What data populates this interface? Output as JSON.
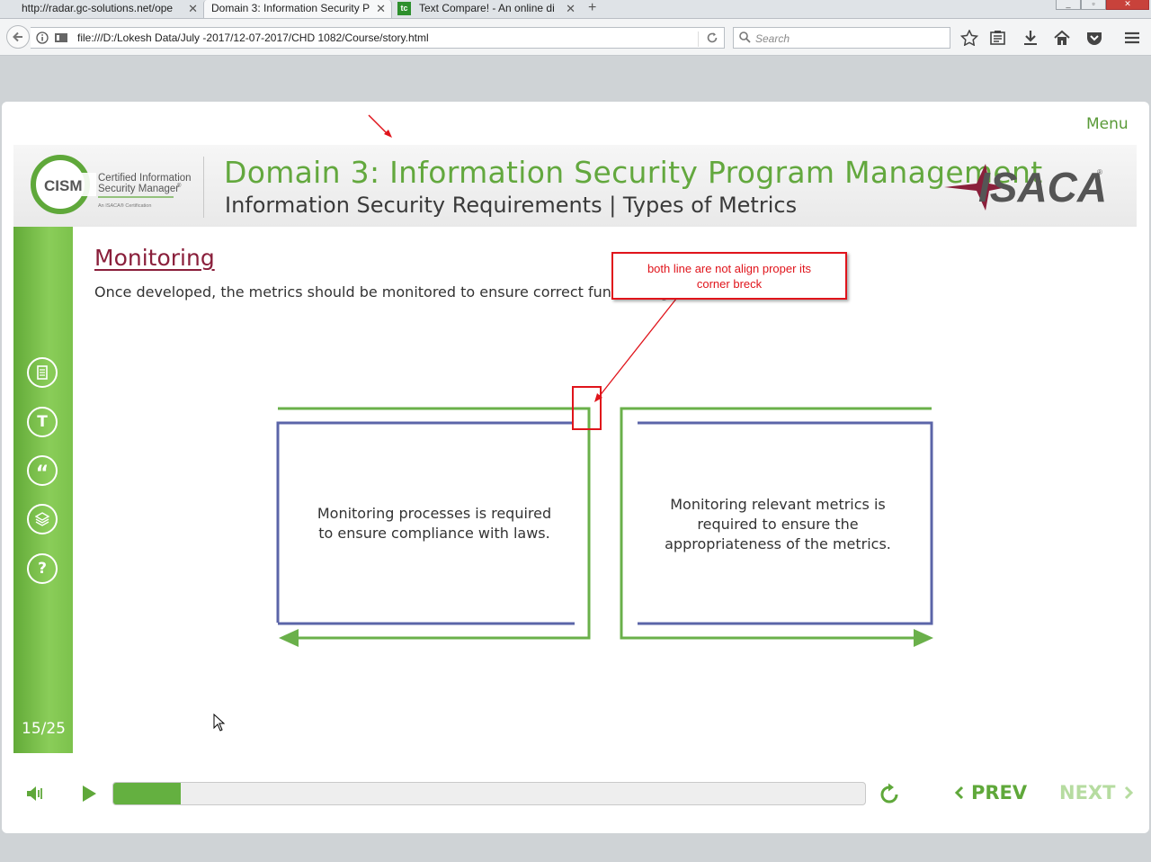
{
  "browser": {
    "tabs": [
      {
        "label": "http://radar.gc-solutions.net/ope",
        "active": false
      },
      {
        "label": "Domain 3: Information Security P",
        "active": true
      },
      {
        "label": "Text Compare! - An online di",
        "active": false,
        "favicon": "tc"
      }
    ],
    "url": "file:///D:/Lokesh Data/July -2017/12-07-2017/CHD 1082/Course/story.html",
    "search_placeholder": "Search"
  },
  "player": {
    "menu_label": "Menu",
    "header": {
      "title": "Domain 3: Information Security Program Management",
      "subtitle": "Information Security Requirements | Types of Metrics",
      "cism_logo": {
        "mark": "CISM",
        "line1": "Certified Information",
        "line2": "Security Manager",
        "reg": "®",
        "tagline": "An ISACA® Certification"
      },
      "isaca_logo": {
        "text": "ISACA",
        "reg": "®"
      }
    },
    "sidebar": {
      "icons": [
        "notes-icon",
        "text-icon",
        "quote-icon",
        "layers-icon",
        "help-icon"
      ],
      "icon_glyphs": {
        "text": "T",
        "quote": "“",
        "help": "?"
      },
      "page_count": "15/25"
    },
    "slide": {
      "title": "Monitoring",
      "text": "Once developed, the metrics should be monitored to ensure correct functioning.",
      "box1_lines": [
        "Monitoring processes is required",
        "to ensure compliance with laws."
      ],
      "box2_lines": [
        "Monitoring relevant metrics is",
        "required to ensure the",
        "appropriateness of the metrics."
      ]
    },
    "annotation": {
      "lines": [
        "both line are not align proper its",
        "corner breck"
      ],
      "color": "#e0141b"
    },
    "controls": {
      "progress": 0.09,
      "prev_label": "PREV",
      "next_label": "NEXT"
    },
    "colors": {
      "green": "#63a83e",
      "blue": "#5b65a8",
      "maroon": "#8a1f3b"
    }
  }
}
